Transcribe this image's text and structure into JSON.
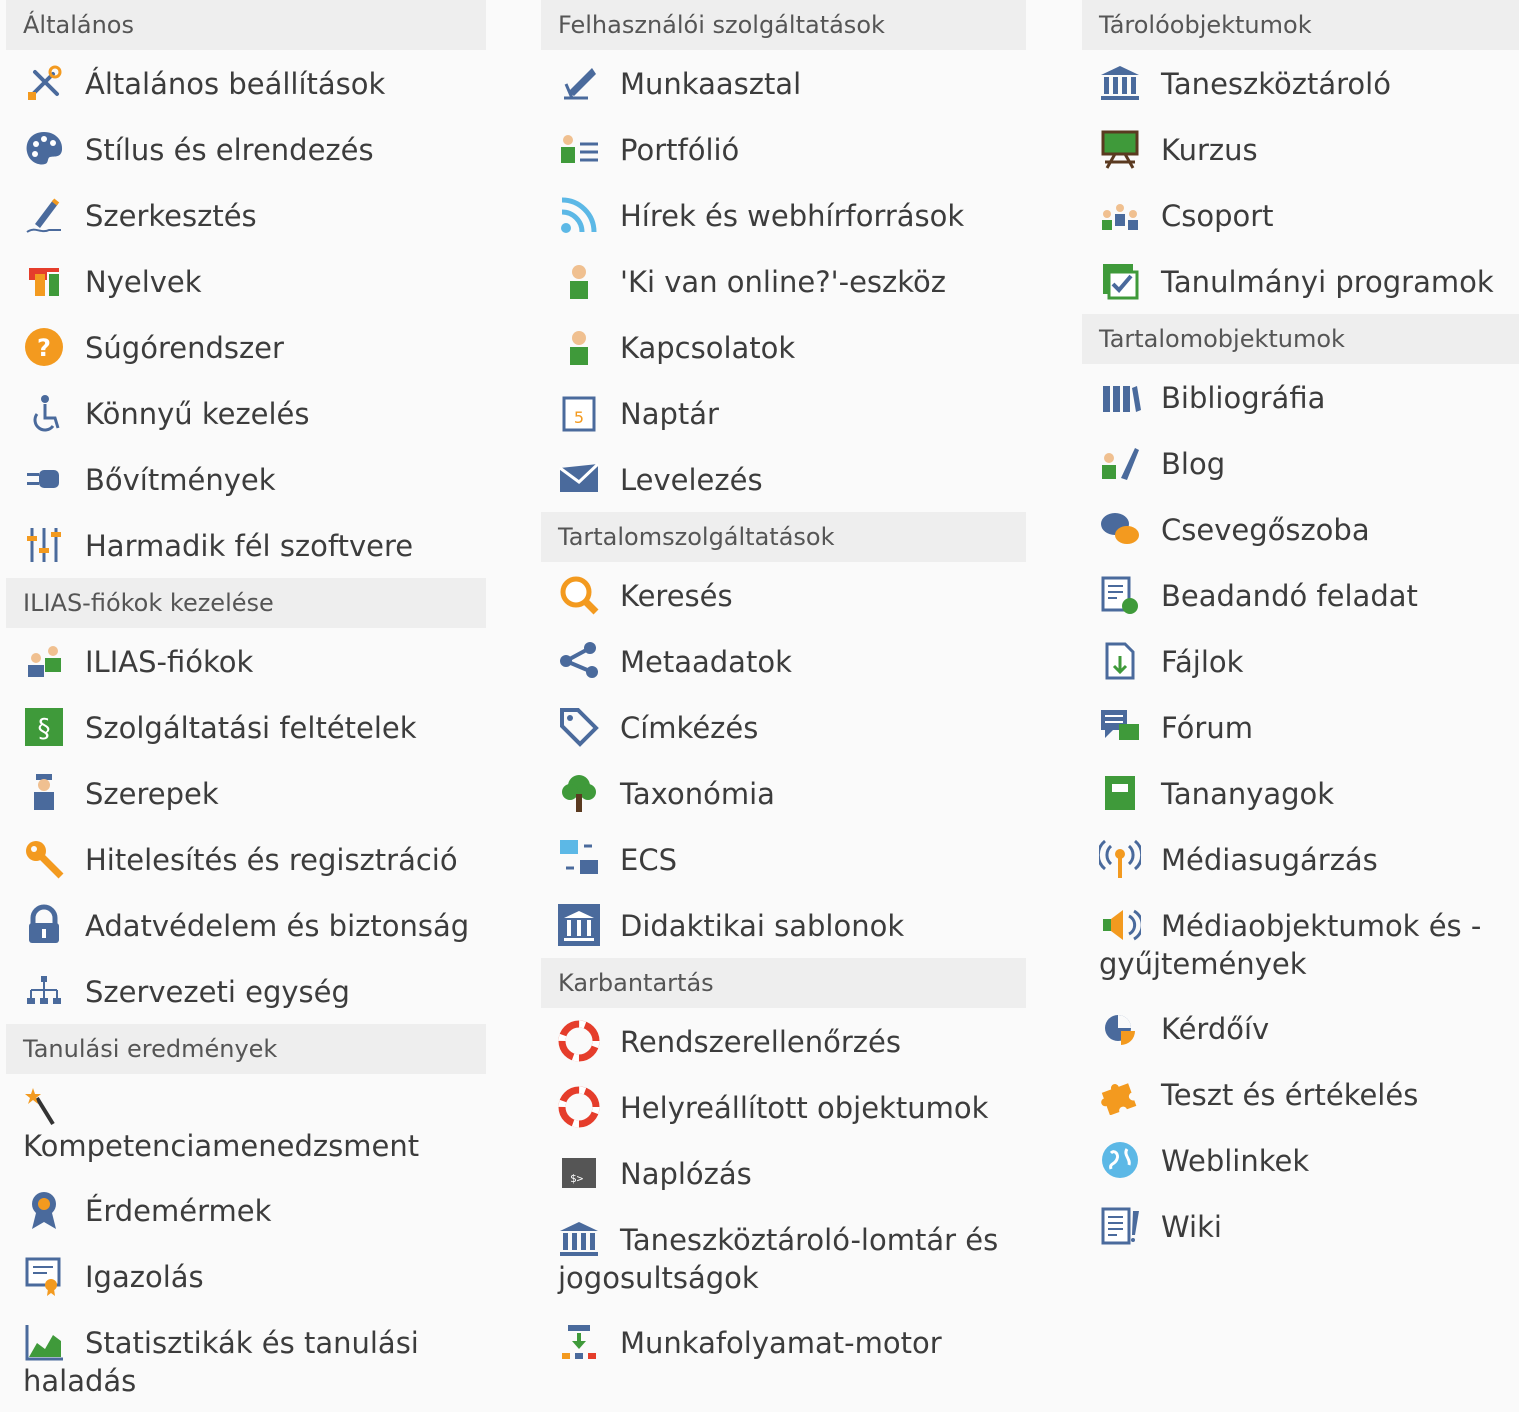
{
  "colors": {
    "header_bg": "#eeeeee",
    "page_bg": "#fafafa",
    "text": "#3c3c3c",
    "orange": "#f39a1f",
    "green": "#3f9a3a",
    "blue": "#4a6a9c",
    "red": "#e53d2b"
  },
  "columns": [
    {
      "sections": [
        {
          "title": "Általános",
          "items": [
            {
              "label": "Általános beállítások",
              "icon": "tools-icon"
            },
            {
              "label": "Stílus és elrendezés",
              "icon": "palette-icon"
            },
            {
              "label": "Szerkesztés",
              "icon": "pen-icon"
            },
            {
              "label": "Nyelvek",
              "icon": "languages-icon"
            },
            {
              "label": "Súgórendszer",
              "icon": "help-icon"
            },
            {
              "label": "Könnyű kezelés",
              "icon": "accessibility-icon"
            },
            {
              "label": "Bővítmények",
              "icon": "plugin-icon"
            },
            {
              "label": "Harmadik fél szoftvere",
              "icon": "sliders-icon"
            }
          ]
        },
        {
          "title": "ILIAS-fiókok kezelése",
          "items": [
            {
              "label": "ILIAS-fiókok",
              "icon": "users-icon"
            },
            {
              "label": "Szolgáltatási feltételek",
              "icon": "paragraph-icon"
            },
            {
              "label": "Szerepek",
              "icon": "role-icon"
            },
            {
              "label": "Hitelesítés és regisztráció",
              "icon": "key-icon"
            },
            {
              "label": "Adatvédelem és biztonság",
              "icon": "lock-icon"
            },
            {
              "label": "Szervezeti egység",
              "icon": "org-unit-icon"
            }
          ]
        },
        {
          "title": "Tanulási eredmények",
          "items": [
            {
              "label": "Kompetenciamenedzsment",
              "icon": "wand-icon",
              "wrap": true
            },
            {
              "label": "Érdemérmek",
              "icon": "badge-icon"
            },
            {
              "label": "Igazolás",
              "icon": "certificate-icon"
            },
            {
              "label": "Statisztikák és tanulási haladás",
              "icon": "chart-icon"
            }
          ]
        }
      ]
    },
    {
      "sections": [
        {
          "title": "Felhasználói szolgáltatások",
          "items": [
            {
              "label": "Munkaasztal",
              "icon": "desk-icon"
            },
            {
              "label": "Portfólió",
              "icon": "portfolio-icon"
            },
            {
              "label": "Hírek és webhírforrások",
              "icon": "rss-icon"
            },
            {
              "label": "'Ki van online?'-eszköz",
              "icon": "user-online-icon"
            },
            {
              "label": "Kapcsolatok",
              "icon": "contacts-icon"
            },
            {
              "label": "Naptár",
              "icon": "calendar-icon"
            },
            {
              "label": "Levelezés",
              "icon": "mail-icon"
            }
          ]
        },
        {
          "title": "Tartalomszolgáltatások",
          "items": [
            {
              "label": "Keresés",
              "icon": "search-icon"
            },
            {
              "label": "Metaadatok",
              "icon": "share-icon"
            },
            {
              "label": "Címkézés",
              "icon": "tag-icon"
            },
            {
              "label": "Taxonómia",
              "icon": "tree-icon"
            },
            {
              "label": "ECS",
              "icon": "ecs-icon"
            },
            {
              "label": "Didaktikai sablonok",
              "icon": "template-icon"
            }
          ]
        },
        {
          "title": "Karbantartás",
          "items": [
            {
              "label": "Rendszerellenőrzés",
              "icon": "lifebuoy-icon"
            },
            {
              "label": "Helyreállított objektumok",
              "icon": "lifebuoy-large-icon"
            },
            {
              "label": "Naplózás",
              "icon": "terminal-icon"
            },
            {
              "label": "Taneszköztároló-lomtár és jogosultságok",
              "icon": "repository-icon"
            },
            {
              "label": "Munkafolyamat-motor",
              "icon": "workflow-icon"
            }
          ]
        }
      ]
    },
    {
      "sections": [
        {
          "title": "Tárolóobjektumok",
          "items": [
            {
              "label": "Taneszköztároló",
              "icon": "repository-icon"
            },
            {
              "label": "Kurzus",
              "icon": "course-icon"
            },
            {
              "label": "Csoport",
              "icon": "group-icon"
            },
            {
              "label": "Tanulmányi programok",
              "icon": "study-program-icon"
            }
          ]
        },
        {
          "title": "Tartalomobjektumok",
          "items": [
            {
              "label": "Bibliográfia",
              "icon": "books-icon"
            },
            {
              "label": "Blog",
              "icon": "blog-icon"
            },
            {
              "label": "Csevegőszoba",
              "icon": "chat-icon"
            },
            {
              "label": "Beadandó feladat",
              "icon": "exercise-icon"
            },
            {
              "label": "Fájlok",
              "icon": "file-icon"
            },
            {
              "label": "Fórum",
              "icon": "forum-icon"
            },
            {
              "label": "Tananyagok",
              "icon": "learning-module-icon"
            },
            {
              "label": "Médiasugárzás",
              "icon": "broadcast-icon"
            },
            {
              "label": "Médiaobjektumok és -gyűjtemények",
              "icon": "speaker-icon"
            },
            {
              "label": "Kérdőív",
              "icon": "survey-icon"
            },
            {
              "label": "Teszt és értékelés",
              "icon": "puzzle-icon"
            },
            {
              "label": "Weblinkek",
              "icon": "weblink-icon"
            },
            {
              "label": "Wiki",
              "icon": "wiki-icon"
            }
          ]
        }
      ]
    }
  ]
}
